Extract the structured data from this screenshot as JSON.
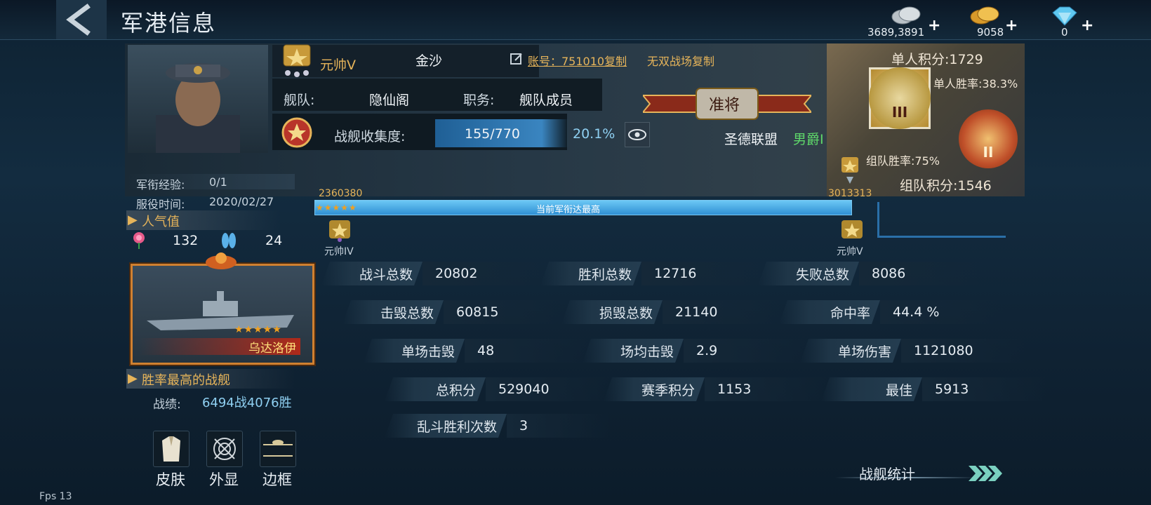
{
  "header": {
    "title": "军港信息",
    "currency": [
      {
        "icon": "silver-coins-icon",
        "value": "3689,3891"
      },
      {
        "icon": "gold-coins-icon",
        "value": "9058"
      },
      {
        "icon": "diamond-icon",
        "value": "0"
      }
    ]
  },
  "profile": {
    "rank_title": "元帅V",
    "name": "金沙",
    "account_label": "账号：751010复制",
    "wushuang_label": "无双战场复制",
    "fleet_label": "舰队:",
    "fleet_value": "隐仙阁",
    "duty_label": "职务:",
    "duty_value": "舰队成员",
    "collection_label": "战舰收集度:",
    "collection_value": "155/770",
    "collection_percent": "20.1%",
    "badge_rank": "准将",
    "alliance": "圣德联盟",
    "noble_title": "男爵I",
    "rank_exp_label": "军衔经验:",
    "rank_exp_value": "0/1",
    "service_label": "服役时间:",
    "service_value": "2020/02/27"
  },
  "scores": {
    "solo_score": "单人积分:1729",
    "solo_winrate": "单人胜率:38.3%",
    "team_winrate": "组队胜率:75%",
    "team_score": "组队积分:1546",
    "medal_solo": "III",
    "medal_team": "II"
  },
  "progress": {
    "left_value": "2360380",
    "right_value": "3013313",
    "bar_text": "当前军衔达最高",
    "fill_fraction": 1.0,
    "left_rank": "元帅IV",
    "right_rank": "元帅V"
  },
  "popularity": {
    "title": "人气值",
    "roses": "132",
    "slippers": "24"
  },
  "ship": {
    "name": "乌达洛伊",
    "stars": 5
  },
  "best_ship": {
    "title": "胜率最高的战舰",
    "record_label": "战绩:",
    "record_value": "6494战4076胜"
  },
  "actions": [
    {
      "icon": "suit-icon",
      "label": "皮肤"
    },
    {
      "icon": "scope-icon",
      "label": "外显"
    },
    {
      "icon": "frame-icon",
      "label": "边框"
    }
  ],
  "stats": [
    {
      "k": "战斗总数",
      "v": "20802"
    },
    {
      "k": "胜利总数",
      "v": "12716"
    },
    {
      "k": "失败总数",
      "v": "8086"
    },
    {
      "k": "击毁总数",
      "v": "60815"
    },
    {
      "k": "损毁总数",
      "v": "21140"
    },
    {
      "k": "命中率",
      "v": "44.4 %"
    },
    {
      "k": "单场击毁",
      "v": "48"
    },
    {
      "k": "场均击毁",
      "v": "2.9"
    },
    {
      "k": "单场伤害",
      "v": "1121080"
    },
    {
      "k": "总积分",
      "v": "529040"
    },
    {
      "k": "赛季积分",
      "v": "1153"
    },
    {
      "k": "最佳",
      "v": "5913"
    },
    {
      "k": "乱斗胜利次数",
      "v": "3"
    }
  ],
  "ship_stats_label": "战舰统计",
  "fps": "Fps 13",
  "colors": {
    "accent_gold": "#e6b45a",
    "progress_blue": "#2f8fd3",
    "green_title": "#5fd86a"
  }
}
